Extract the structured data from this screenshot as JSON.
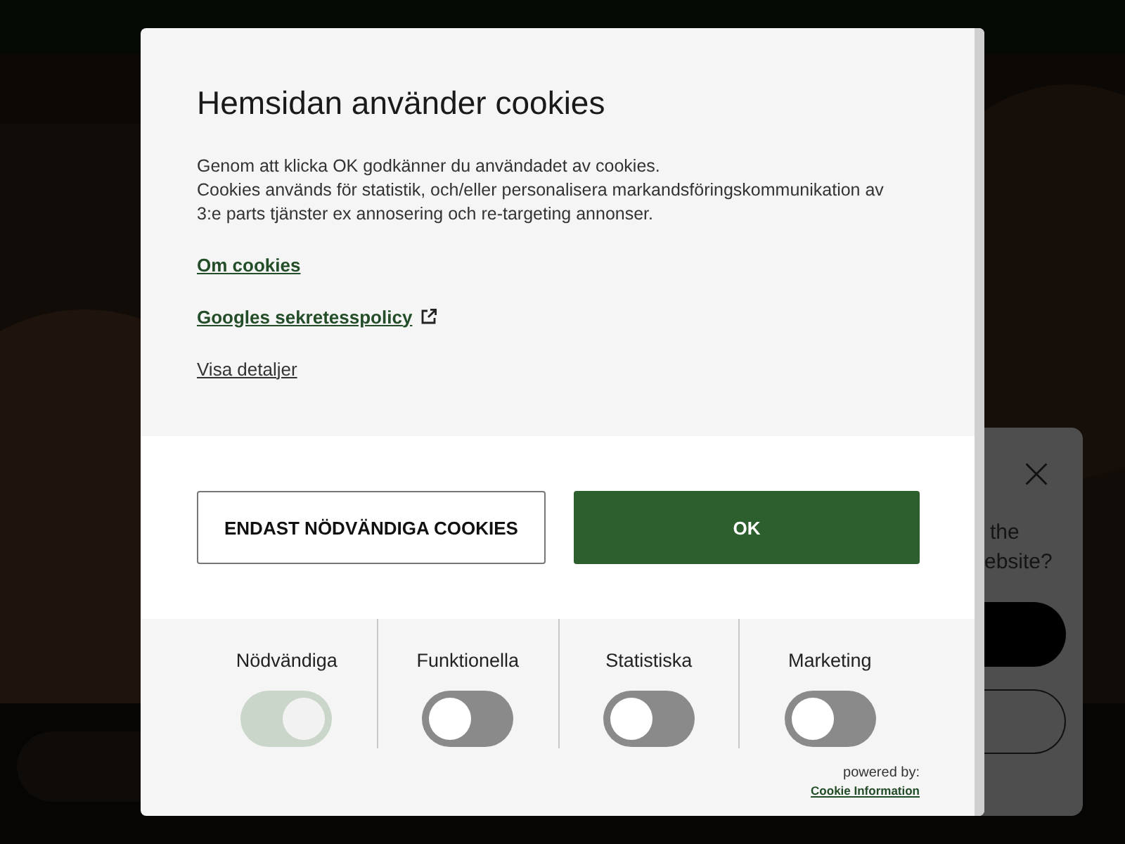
{
  "background_card": {
    "lines": [
      "the",
      "ebsite?"
    ]
  },
  "dialog": {
    "title": "Hemsidan använder cookies",
    "text": [
      "Genom att klicka OK godkänner du användadet av cookies.",
      "Cookies används för statistik, och/eller personalisera markandsföringskommunikation av 3:e parts tjänster ex annosering och re-targeting annonser."
    ],
    "links": [
      {
        "label": "Om cookies",
        "kind": "bold",
        "external": false
      },
      {
        "label": "Googles sekretesspolicy",
        "kind": "bold",
        "external": true
      },
      {
        "label": "Visa detaljer",
        "kind": "plain",
        "external": false
      }
    ],
    "buttons": [
      {
        "label": "ENDAST NÖDVÄNDIGA COOKIES",
        "kind": "outline"
      },
      {
        "label": "OK",
        "kind": "primary"
      }
    ],
    "categories": [
      {
        "label": "Nödvändiga",
        "on": true,
        "disabled": true
      },
      {
        "label": "Funktionella",
        "on": false,
        "disabled": false
      },
      {
        "label": "Statistiska",
        "on": false,
        "disabled": false
      },
      {
        "label": "Marketing",
        "on": false,
        "disabled": false
      }
    ],
    "powered_by": "powered by:",
    "provider_link": "Cookie Information"
  }
}
